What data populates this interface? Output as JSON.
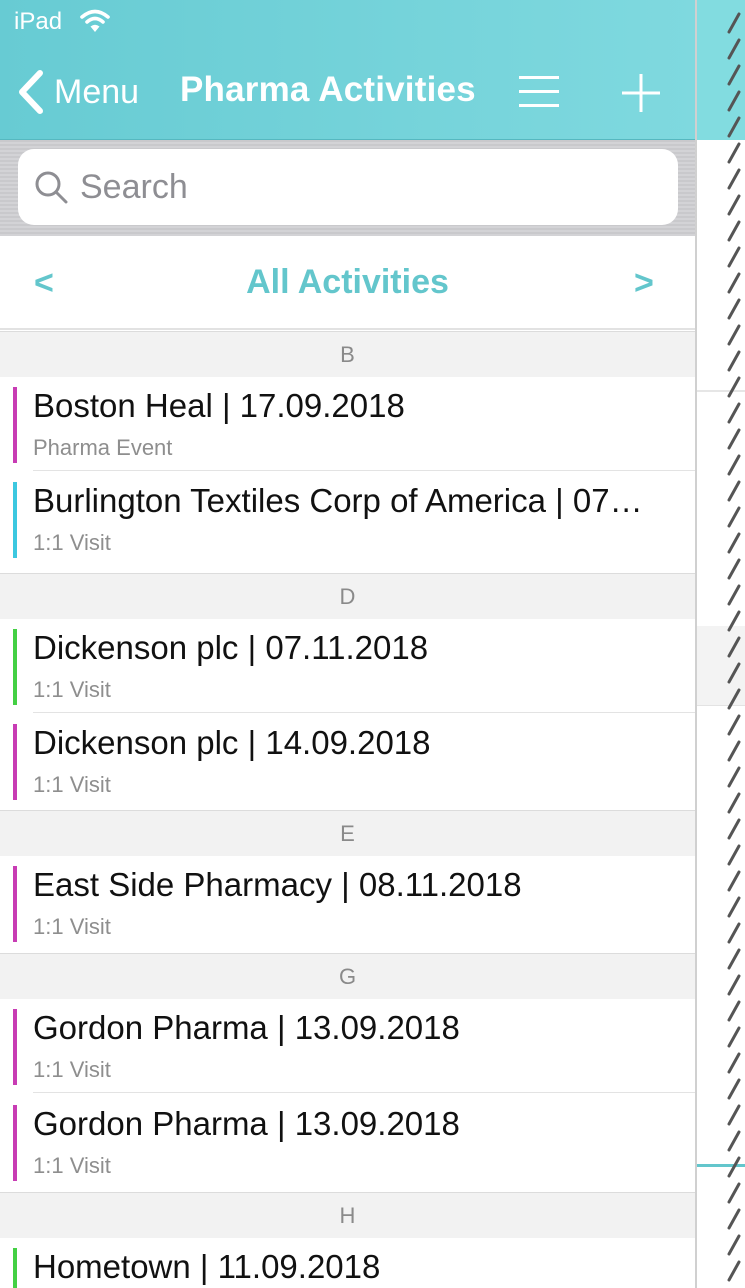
{
  "status_bar": {
    "device": "iPad"
  },
  "nav": {
    "back_label": "Menu",
    "title": "Pharma Activities"
  },
  "search": {
    "placeholder": "Search"
  },
  "filter": {
    "prev": "<",
    "title": "All Activities",
    "next": ">"
  },
  "colors": {
    "accent": "#63c6cc",
    "nav_background": "#74d3d9",
    "event_bar": "#c83cb4",
    "visit_bar_cyan": "#3cc8e0",
    "visit_bar_green": "#44d044"
  },
  "sections": [
    {
      "letter": "B",
      "items": [
        {
          "title": "Boston Heal | 17.09.2018",
          "subtitle": "Pharma Event",
          "bar_color": "#c83cb4"
        },
        {
          "title": "Burlington Textiles Corp of America | 07…",
          "subtitle": "1:1 Visit",
          "bar_color": "#3cc8e0"
        }
      ]
    },
    {
      "letter": "D",
      "items": [
        {
          "title": "Dickenson plc | 07.11.2018",
          "subtitle": "1:1 Visit",
          "bar_color": "#44d044"
        },
        {
          "title": "Dickenson plc | 14.09.2018",
          "subtitle": "1:1 Visit",
          "bar_color": "#c83cb4"
        }
      ]
    },
    {
      "letter": "E",
      "items": [
        {
          "title": "East Side Pharmacy | 08.11.2018",
          "subtitle": "1:1 Visit",
          "bar_color": "#c83cb4"
        }
      ]
    },
    {
      "letter": "G",
      "items": [
        {
          "title": "Gordon Pharma | 13.09.2018",
          "subtitle": "1:1 Visit",
          "bar_color": "#c83cb4"
        },
        {
          "title": "Gordon Pharma | 13.09.2018",
          "subtitle": "1:1 Visit",
          "bar_color": "#c83cb4"
        }
      ]
    },
    {
      "letter": "H",
      "items": [
        {
          "title": "Hometown | 11.09.2018",
          "subtitle": "",
          "bar_color": "#44d044"
        }
      ]
    }
  ]
}
